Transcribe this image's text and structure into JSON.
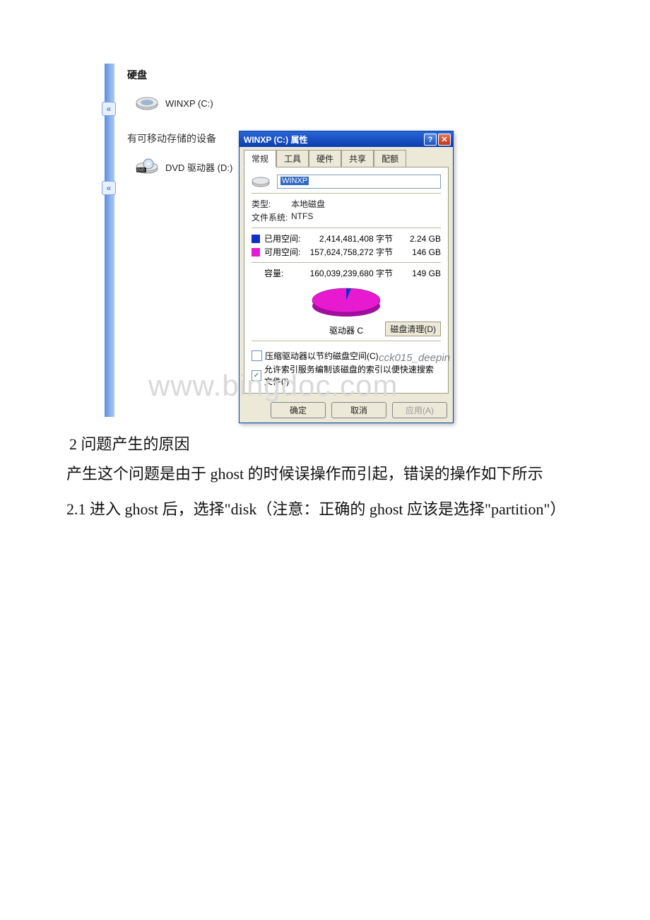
{
  "explorer": {
    "section_disks": "硬盘",
    "drive_c": "WINXP (C:)",
    "section_removable": "有可移动存储的设备",
    "drive_d": "DVD 驱动器 (D:)"
  },
  "dialog": {
    "title": "WINXP (C:) 属性",
    "tabs": [
      "常规",
      "工具",
      "硬件",
      "共享",
      "配额"
    ],
    "volume_name": "WINXP",
    "type_label": "类型:",
    "type_value": "本地磁盘",
    "fs_label": "文件系统:",
    "fs_value": "NTFS",
    "used_label": "已用空间:",
    "used_bytes": "2,414,481,408 字节",
    "used_gb": "2.24 GB",
    "free_label": "可用空间:",
    "free_bytes": "157,624,758,272 字节",
    "free_gb": "146 GB",
    "capacity_label": "容量:",
    "capacity_bytes": "160,039,239,680 字节",
    "capacity_gb": "149 GB",
    "drive_caption": "驱动器 C",
    "disk_cleanup": "磁盘清理(D)",
    "compress_cb": "压缩驱动器以节约磁盘空间(C)",
    "index_cb": "允许索引服务编制该磁盘的索引以便快速搜索文件(I)",
    "ok": "确定",
    "cancel": "取消",
    "apply": "应用(A)"
  },
  "author_mark": "cck015_deepin",
  "doc": {
    "line1": "2 问题产生的原因",
    "line2": "产生这个问题是由于 ghost 的时候误操作而引起，错误的操作如下所示",
    "line3": "2.1 进入 ghost 后，选择\"disk（注意：正确的 ghost 应该是选择\"partition\"）"
  },
  "watermark": "www.bingdoc.com",
  "chart_data": {
    "type": "pie",
    "title": "驱动器 C",
    "series": [
      {
        "name": "已用空间",
        "value": 2414481408,
        "display": "2.24 GB",
        "color": "#1030c8"
      },
      {
        "name": "可用空间",
        "value": 157624758272,
        "display": "146 GB",
        "color": "#e81ad0"
      }
    ],
    "total": {
      "name": "容量",
      "value": 160039239680,
      "display": "149 GB"
    }
  }
}
